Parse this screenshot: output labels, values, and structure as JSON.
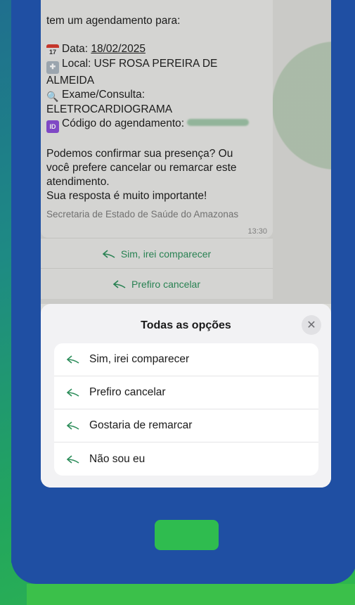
{
  "chat": {
    "lines": {
      "intro": "tem um agendamento para:",
      "date_label": "Data: ",
      "date_value": "18/02/2025",
      "local_line1": "Local: USF ROSA PEREIRA DE",
      "local_line2": "ALMEIDA",
      "exam_label": "Exame/Consulta:",
      "exam_value": "ELETROCARDIOGRAMA",
      "code_label": "Código do agendamento: ",
      "question1": "Podemos confirmar sua presença? Ou",
      "question2": "você prefere cancelar ou remarcar este",
      "question3": "atendimento.",
      "importance": "Sua resposta é muito importante!"
    },
    "calendar_day": "17",
    "id_badge": "ID",
    "sender": "Secretaria de Estado de Saúde do Amazonas",
    "time": "13:30",
    "quick_replies": [
      "Sim, irei comparecer",
      "Prefiro cancelar"
    ]
  },
  "sheet": {
    "title": "Todas as opções",
    "close_glyph": "✕",
    "options": [
      "Sim, irei comparecer",
      "Prefiro cancelar",
      "Gostaria de remarcar",
      "Não sou eu"
    ]
  },
  "colors": {
    "phone_frame": "#1f4fa3",
    "accent_green": "#2c8d5a",
    "home_button": "#2fbc4f"
  },
  "icons": {
    "reply": "reply-arrow-icon",
    "close": "close-icon",
    "calendar": "calendar-icon",
    "hospital": "hospital-icon",
    "search": "magnifier-icon",
    "id": "id-badge-icon"
  }
}
